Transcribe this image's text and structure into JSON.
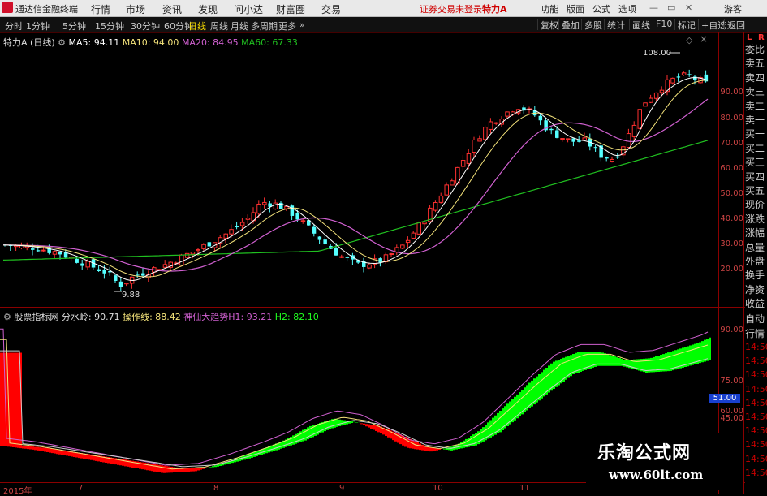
{
  "titlebar": {
    "app_name": "通达信金融终端",
    "menus": [
      "行情",
      "市场",
      "资讯",
      "发现",
      "问小达",
      "财富圈",
      "交易"
    ],
    "login_status": "证券交易未登录",
    "stock": "特力A",
    "right_menus": [
      "功能",
      "版面",
      "公式",
      "选项"
    ],
    "guest": "游客"
  },
  "toolbar": {
    "periods": [
      "分时",
      "1分钟",
      "5分钟",
      "15分钟",
      "30分钟",
      "60分钟",
      "日线",
      "周线",
      "月线",
      "多周期",
      "更多"
    ],
    "active_period": "日线",
    "right_buttons": [
      "复权",
      "叠加",
      "多股",
      "统计",
      "画线",
      "F10",
      "标记",
      "+自选",
      "返回"
    ]
  },
  "main_chart": {
    "stock_label": "特力A",
    "period_label": "(日线)",
    "ma5": "MA5: 94.11",
    "ma10": "MA10: 94.00",
    "ma20": "MA20: 84.95",
    "ma60": "MA60: 67.33",
    "high_label": "108.00",
    "low_label": "9.88",
    "y_ticks": [
      "90.00",
      "80.00",
      "70.00",
      "60.00",
      "50.00",
      "40.00",
      "30.00",
      "20.00"
    ]
  },
  "sub_chart": {
    "name": "股票指标网",
    "fenshui": "分水岭: 90.71",
    "caozuo": "操作线: 88.42",
    "shenshan": "神仙大趋势",
    "h1": "H1: 93.21",
    "h2": "H2: 82.10",
    "y_ticks": [
      "90.00",
      "75.00",
      "60.00",
      "45.00"
    ],
    "current_value": "51.00"
  },
  "x_axis": [
    "2015年",
    "7",
    "8",
    "9",
    "10",
    "11"
  ],
  "side_panel": {
    "top_labels": [
      "L",
      "R"
    ],
    "items": [
      "委比",
      "卖五",
      "卖四",
      "卖三",
      "卖二",
      "卖一",
      "买一",
      "买二",
      "买三",
      "买四",
      "买五",
      "现价",
      "涨跌",
      "涨幅",
      "总量",
      "外盘",
      "换手",
      "净资",
      "收益"
    ],
    "bottom_items": [
      "自动",
      "行情"
    ],
    "times": [
      "14:50",
      "14:50",
      "14:50",
      "14:50",
      "14:50",
      "14:50",
      "14:50",
      "14:50",
      "14:50",
      "14:50"
    ]
  },
  "watermark": {
    "cn": "乐淘公式网",
    "url": "www.60lt.com"
  },
  "colors": {
    "up": "#ff3030",
    "down": "#54ffff",
    "ma5": "#ffffff",
    "ma10": "#f3e27a",
    "ma20": "#d060d0",
    "ma60": "#20c020",
    "green_fill": "#00ff00",
    "red_fill": "#ff0000"
  }
}
